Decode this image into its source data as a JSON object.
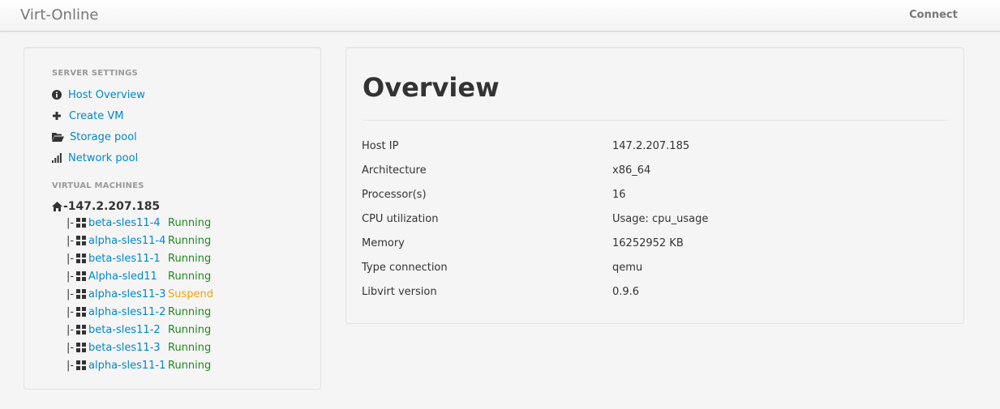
{
  "navbar": {
    "brand": "Virt-Online",
    "connect_label": "Connect"
  },
  "sidebar": {
    "server_header": "SERVER SETTINGS",
    "menu": [
      {
        "label": "Host Overview",
        "icon": "info-circle-icon"
      },
      {
        "label": "Create VM",
        "icon": "plus-icon"
      },
      {
        "label": "Storage pool",
        "icon": "folder-open-icon"
      },
      {
        "label": "Network pool",
        "icon": "signal-icon"
      }
    ],
    "vm_header": "VIRTUAL MACHINES",
    "host": {
      "label": "-147.2.207.185",
      "icon": "home-icon"
    },
    "tree_prefix": "|-",
    "vms": [
      {
        "name": "beta-sles11-4",
        "status": "Running"
      },
      {
        "name": "alpha-sles11-4",
        "status": "Running"
      },
      {
        "name": "beta-sles11-1",
        "status": "Running"
      },
      {
        "name": "Alpha-sled11",
        "status": "Running"
      },
      {
        "name": "alpha-sles11-3",
        "status": "Suspend"
      },
      {
        "name": "alpha-sles11-2",
        "status": "Running"
      },
      {
        "name": "beta-sles11-2",
        "status": "Running"
      },
      {
        "name": "beta-sles11-3",
        "status": "Running"
      },
      {
        "name": "alpha-sles11-1",
        "status": "Running"
      }
    ]
  },
  "main": {
    "title": "Overview",
    "info": [
      {
        "key": "Host IP",
        "value": "147.2.207.185"
      },
      {
        "key": "Architecture",
        "value": "x86_64"
      },
      {
        "key": "Processor(s)",
        "value": "16"
      },
      {
        "key": "CPU utilization",
        "value": "Usage: cpu_usage"
      },
      {
        "key": "Memory",
        "value": "16252952 KB"
      },
      {
        "key": "Type connection",
        "value": "qemu"
      },
      {
        "key": "Libvirt version",
        "value": "0.9.6"
      }
    ]
  },
  "colors": {
    "link": "#0088cc",
    "running": "#1e8a1e",
    "suspend": "#f0a30a"
  }
}
